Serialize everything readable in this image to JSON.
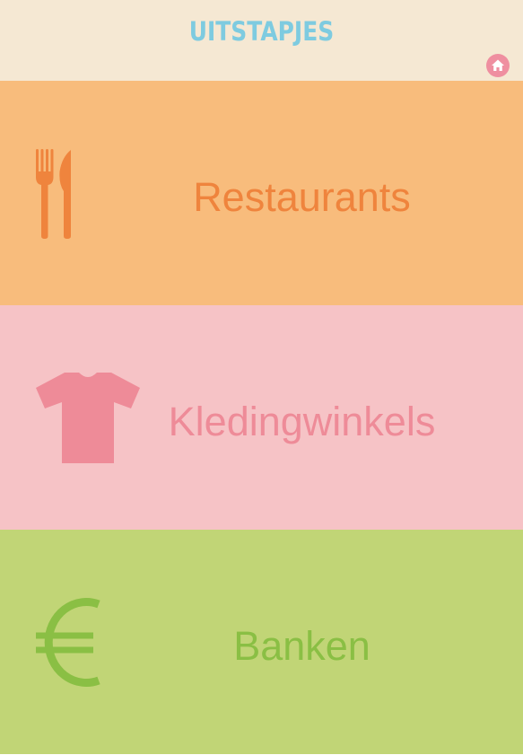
{
  "header": {
    "title": "UITSTAPJES",
    "home_icon": "home-icon"
  },
  "tiles": [
    {
      "label": "Restaurants",
      "icon": "fork-knife-icon",
      "background": "#f8bc7c",
      "color": "#ef843d"
    },
    {
      "label": "Kledingwinkels",
      "icon": "tshirt-icon",
      "background": "#f6c3c6",
      "color": "#ee8b98"
    },
    {
      "label": "Banken",
      "icon": "euro-icon",
      "background": "#c1d576",
      "color": "#8abf44"
    }
  ],
  "colors": {
    "header_background": "#f5e8d3",
    "title_color": "#7ecbe0",
    "home_button": "#ef8fa0"
  }
}
